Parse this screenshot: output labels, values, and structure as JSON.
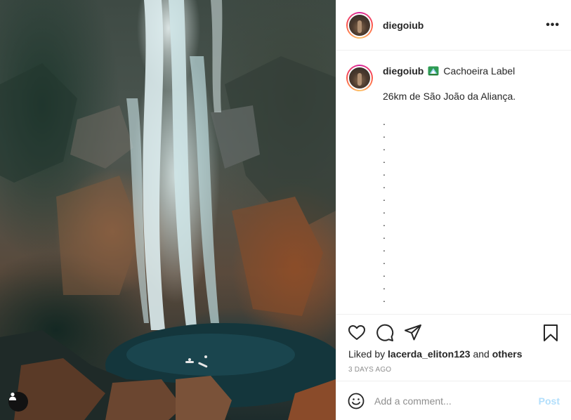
{
  "post": {
    "author": "diegoiub",
    "more_icon_glyph": "•••",
    "caption": {
      "author": "diegoiub",
      "location_icon": "national-park-emoji",
      "location": "Cachoeira Label",
      "text": "26km de São João da Aliança.",
      "dots": [
        ".",
        ".",
        ".",
        ".",
        ".",
        ".",
        ".",
        ".",
        ".",
        ".",
        ".",
        ".",
        ".",
        ".",
        "."
      ]
    },
    "likes": {
      "prefix": "Liked by",
      "user": "lacerda_eliton123",
      "joiner": "and",
      "others": "others"
    },
    "timestamp": "3 DAYS AGO",
    "comment": {
      "placeholder": "Add a comment...",
      "post_label": "Post"
    }
  },
  "colors": {
    "post_button": "#b2dffc",
    "secondary_text": "#8e8e8e",
    "story_ring": [
      "#d6249f",
      "#fd5949",
      "#fdc468"
    ]
  }
}
